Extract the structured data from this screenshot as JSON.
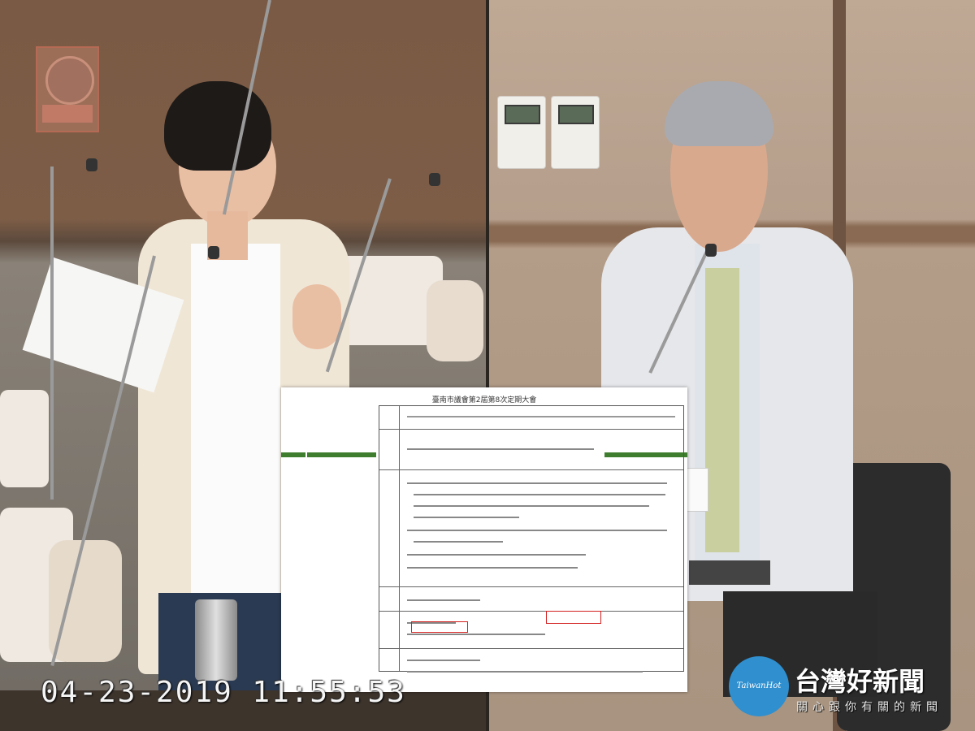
{
  "overlay": {
    "timestamp": "04-23-2019 11:55:53",
    "logo": {
      "circle_text": "TaiwanHot",
      "name": "台灣好新聞",
      "slogan": "關心跟你有關的新聞",
      "circle_color": "#2f8fcf"
    }
  },
  "document": {
    "title": "臺南市議會第2屆第8次定期大會",
    "accent_color": "#3e7d2e",
    "highlight_color": "#d32020"
  }
}
